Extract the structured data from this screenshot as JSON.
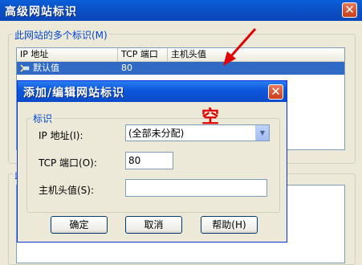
{
  "outer_window": {
    "title": "高级网站标识",
    "close_glyph": "✕",
    "group1_label": "此网站的多个标识(M)",
    "list_columns": [
      "IP 地址",
      "TCP 端口",
      "主机头值"
    ],
    "list_rows": [
      {
        "ip": "默认值",
        "port": "80",
        "host": ""
      }
    ],
    "group2_label_partial": "此"
  },
  "dialog": {
    "title": "添加/编辑网站标识",
    "close_glyph": "✕",
    "group_label": "标识",
    "ip_label": "IP 地址(I):",
    "ip_value": "(全部未分配)",
    "port_label": "TCP 端口(O):",
    "port_value": "80",
    "host_label": "主机头值(S):",
    "host_value": "",
    "ok_label": "确定",
    "cancel_label": "取消",
    "help_label": "帮助(H)"
  },
  "annotation": {
    "empty_text": "空",
    "color": "#e00000"
  }
}
